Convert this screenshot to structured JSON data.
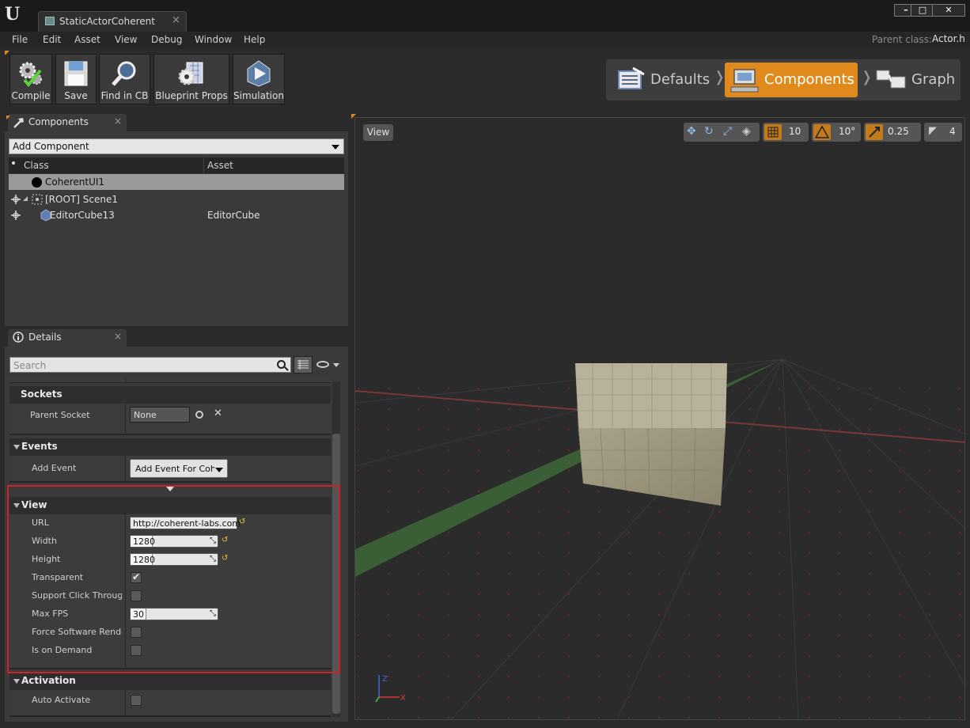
{
  "window": {
    "tab_title": "StaticActorCoherent",
    "tab_close": "×",
    "logo": "U",
    "buttons": {
      "minimize": "–",
      "maximize": "□",
      "close": "✕"
    }
  },
  "menu": {
    "items": [
      "File",
      "Edit",
      "Asset",
      "View",
      "Debug",
      "Window",
      "Help"
    ],
    "parent_class_label": "Parent class:",
    "parent_class_value": "Actor.h"
  },
  "toolbar": {
    "buttons": [
      {
        "label": "Compile",
        "icon": "gears-check-icon"
      },
      {
        "label": "Save",
        "icon": "floppy-icon"
      },
      {
        "label": "Find in CB",
        "icon": "magnifier-icon"
      },
      {
        "label": "Blueprint Props",
        "icon": "gear-grid-icon"
      },
      {
        "label": "Simulation",
        "icon": "play-icon"
      }
    ]
  },
  "modes": {
    "defaults": "Defaults",
    "components": "Components",
    "graph": "Graph",
    "separator": "❭",
    "active": "Components",
    "active_color": "#e08a1e"
  },
  "components_panel": {
    "tab_label": "Components",
    "tab_close": "×",
    "add_component": "Add Component",
    "columns": {
      "class": "Class",
      "asset": "Asset"
    },
    "rows": [
      {
        "name": "CoherentUI1",
        "asset": ""
      },
      {
        "name": "[ROOT] Scene1",
        "asset": ""
      },
      {
        "name": "EditorCube13",
        "asset": "EditorCube"
      }
    ]
  },
  "details_panel": {
    "tab_label": "Details",
    "tab_close": "×",
    "search_placeholder": "Search",
    "sockets": {
      "title": "Sockets",
      "parent_socket_label": "Parent Socket",
      "parent_socket_value": "None"
    },
    "events": {
      "title": "Events",
      "add_event_label": "Add Event",
      "add_event_value": "Add Event For Coherent"
    },
    "view": {
      "title": "View",
      "url_label": "URL",
      "url_value": "http://coherent-labs.com",
      "width_label": "Width",
      "width_value": "1280",
      "height_label": "Height",
      "height_value": "1280",
      "transparent_label": "Transparent",
      "transparent_checked": true,
      "support_click_label": "Support Click Through",
      "support_click_checked": false,
      "max_fps_label": "Max FPS",
      "max_fps_value": "30",
      "force_sw_label": "Force Software Rendering",
      "force_sw_checked": false,
      "on_demand_label": "Is on Demand",
      "on_demand_checked": false
    },
    "activation": {
      "title": "Activation",
      "auto_activate_label": "Auto Activate",
      "auto_activate_checked": false
    }
  },
  "viewport": {
    "view_button": "View",
    "grid_snap": "10",
    "rot_snap": "10°",
    "scale_snap": "0.25",
    "camera_speed": "4",
    "axis_labels": {
      "x": "X",
      "z": "Z"
    }
  }
}
